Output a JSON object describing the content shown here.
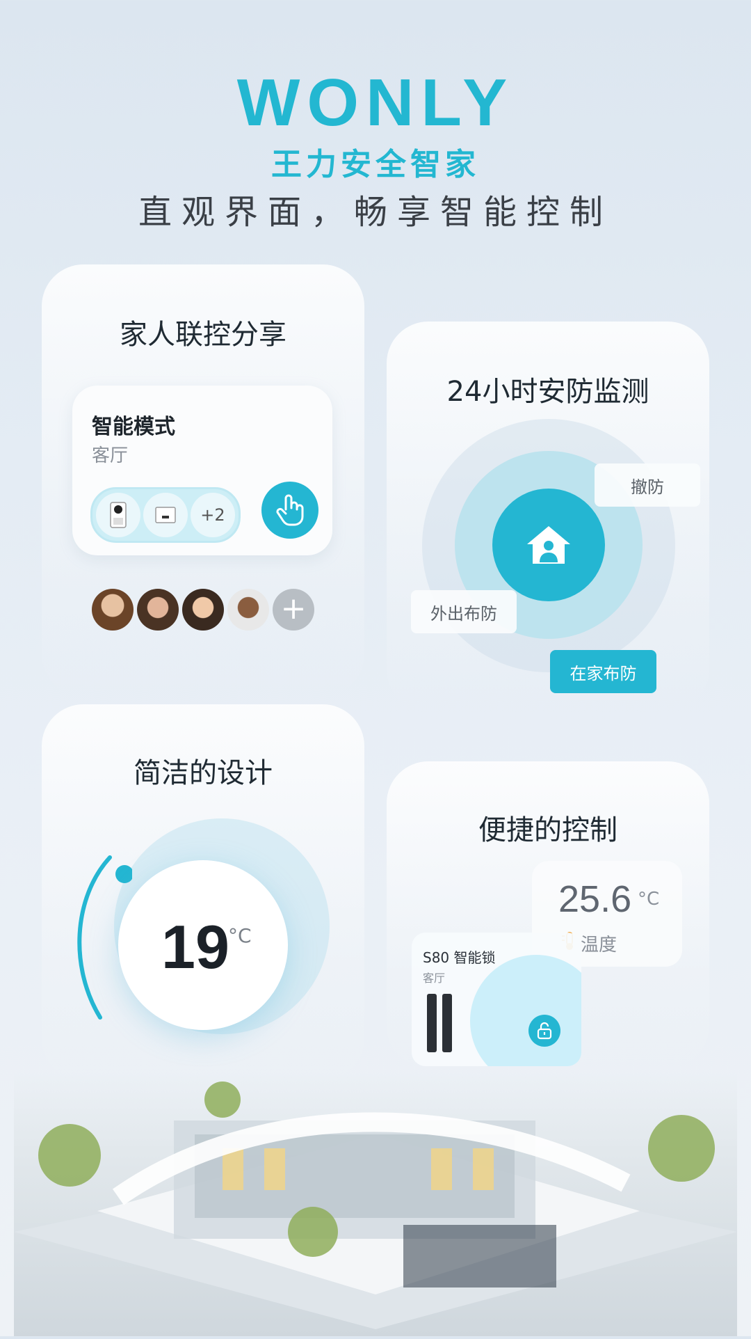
{
  "brand": {
    "logo_text": "WONLY",
    "logo_sub": "王力安全智家",
    "tagline": "直观界面，畅享智能控制"
  },
  "family_card": {
    "title": "家人联控分享",
    "mode_name": "智能模式",
    "mode_room": "客厅",
    "device_more": "+2",
    "add_member": "+"
  },
  "security_card": {
    "title": "24小时安防监测",
    "disarm": "撤防",
    "away_arm": "外出布防",
    "home_arm": "在家布防"
  },
  "design_card": {
    "title": "简洁的设计",
    "temperature": "19",
    "unit": "°C"
  },
  "control_card": {
    "title": "便捷的控制",
    "temp_value": "25.6",
    "temp_unit": "°C",
    "temp_label": "温度",
    "lock_name": "S80 智能锁",
    "lock_room": "客厅"
  },
  "colors": {
    "accent": "#24b6d2",
    "background": "#e4ecf4"
  }
}
